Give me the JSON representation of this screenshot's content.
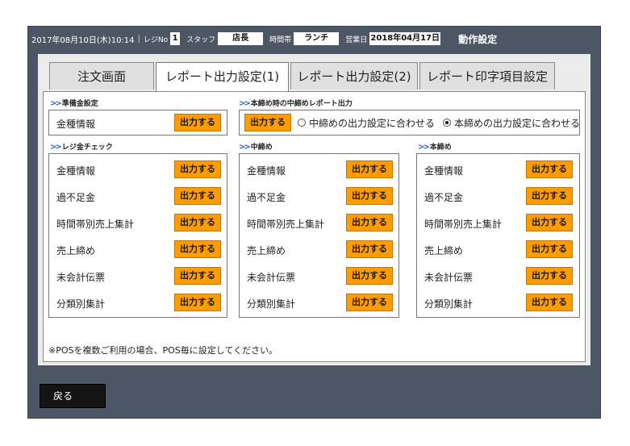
{
  "header": {
    "datetime": "2017年08月10日(木)10:14",
    "register_label": "レジNo",
    "register_value": "1",
    "staff_label": "スタッフ",
    "staff_value": "店長",
    "timeslot_label": "時間帯",
    "timeslot_value": "ランチ",
    "business_day_label": "営業日",
    "business_day_value": "2018年04月17日",
    "mode_title": "動作設定"
  },
  "tabs": [
    {
      "label": "注文画面",
      "active": false
    },
    {
      "label": "レポート出力設定(1)",
      "active": true
    },
    {
      "label": "レポート出力設定(2)",
      "active": false
    },
    {
      "label": "レポート印字項目設定",
      "active": false
    }
  ],
  "output_button_label": "出力する",
  "reserve_fund": {
    "title": "準備金設定",
    "item": "金種情報"
  },
  "interim_close": {
    "title": "本締め時の中締めレポート出力",
    "option1": "中締めの出力設定に合わせる",
    "option2": "本締めの出力設定に合わせる",
    "selected": "option2"
  },
  "columns": [
    {
      "title": "レジ金チェック",
      "items": [
        "金種情報",
        "過不足金",
        "時間帯別売上集計",
        "売上締め",
        "未会計伝票",
        "分類別集計"
      ]
    },
    {
      "title": "中締め",
      "items": [
        "金種情報",
        "過不足金",
        "時間帯別売上集計",
        "売上締め",
        "未会計伝票",
        "分類別集計"
      ]
    },
    {
      "title": "本締め",
      "items": [
        "金種情報",
        "過不足金",
        "時間帯別売上集計",
        "売上締め",
        "未会計伝票",
        "分類別集計"
      ]
    }
  ],
  "note": "※POSを複数ご利用の場合、POS毎に設定してください。",
  "back_button": "戻る",
  "colors": {
    "accent": "#ff9d00",
    "frame": "#4d5665",
    "section_marker": "#2b63b8"
  }
}
